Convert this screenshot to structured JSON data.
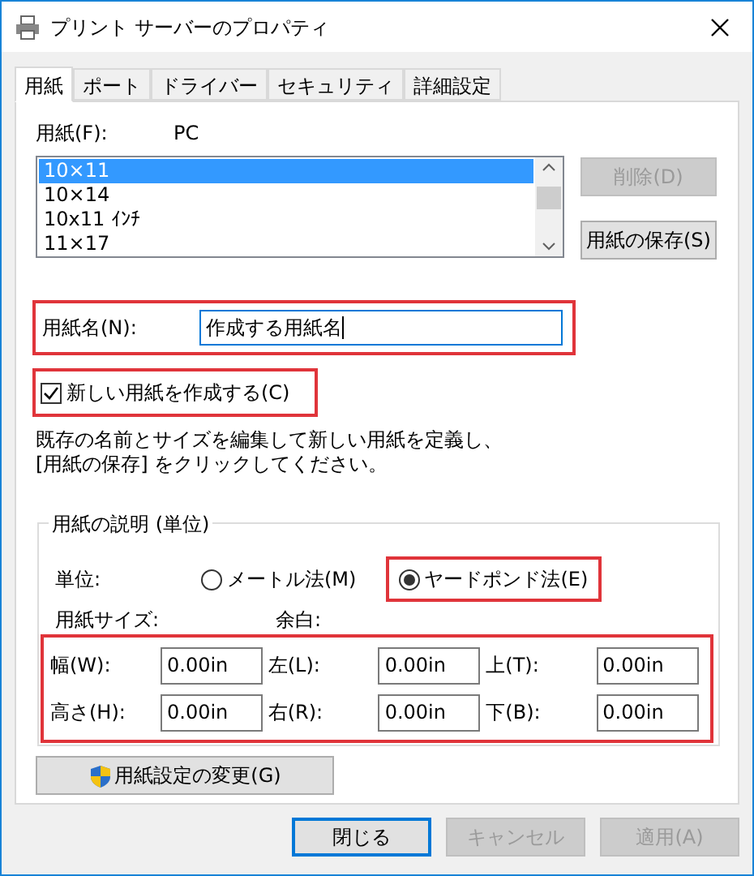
{
  "window": {
    "title": "プリント サーバーのプロパティ"
  },
  "tabs": [
    {
      "label": "用紙",
      "selected": true
    },
    {
      "label": "ポート",
      "selected": false
    },
    {
      "label": "ドライバー",
      "selected": false
    },
    {
      "label": "セキュリティ",
      "selected": false
    },
    {
      "label": "詳細設定",
      "selected": false
    }
  ],
  "paper": {
    "label": "用紙(F):",
    "server": "PC",
    "items": [
      {
        "label": "10×11",
        "selected": true
      },
      {
        "label": "10×14",
        "selected": false
      },
      {
        "label": "10x11 ｲﾝﾁ",
        "selected": false
      },
      {
        "label": "11×17",
        "selected": false
      }
    ],
    "buttons": [
      {
        "label": "削除(D)",
        "disabled": true
      },
      {
        "label": "用紙の保存(S)",
        "disabled": false
      }
    ]
  },
  "name_field": {
    "label": "用紙名(N):",
    "value": "作成する用紙名",
    "highlighted": true
  },
  "new_form": {
    "label": "新しい用紙を作成する(C)",
    "checked": true,
    "highlighted": true
  },
  "hint": "既存の名前とサイズを編集して新しい用紙を定義し、[用紙の保存] をクリックしてください。",
  "description": {
    "title": "用紙の説明 (単位)",
    "unit_label": "単位:",
    "units": [
      {
        "label": "メートル法(M)",
        "selected": false,
        "highlighted": false
      },
      {
        "label": "ヤードポンド法(E)",
        "selected": true,
        "highlighted": true
      }
    ],
    "size_label": "用紙サイズ:",
    "margin_label": "余白:",
    "fields_highlighted": true,
    "fields": [
      [
        {
          "label": "幅(W):",
          "value": "0.00in"
        },
        {
          "label": "左(L):",
          "value": "0.00in"
        },
        {
          "label": "上(T):",
          "value": "0.00in"
        }
      ],
      [
        {
          "label": "高さ(H):",
          "value": "0.00in"
        },
        {
          "label": "右(R):",
          "value": "0.00in"
        },
        {
          "label": "下(B):",
          "value": "0.00in"
        }
      ]
    ]
  },
  "change_button": "用紙設定の変更(G)",
  "buttons": [
    {
      "label": "閉じる",
      "disabled": false,
      "default": true
    },
    {
      "label": "キャンセル",
      "disabled": true,
      "default": false
    },
    {
      "label": "適用(A)",
      "disabled": true,
      "default": false
    }
  ]
}
